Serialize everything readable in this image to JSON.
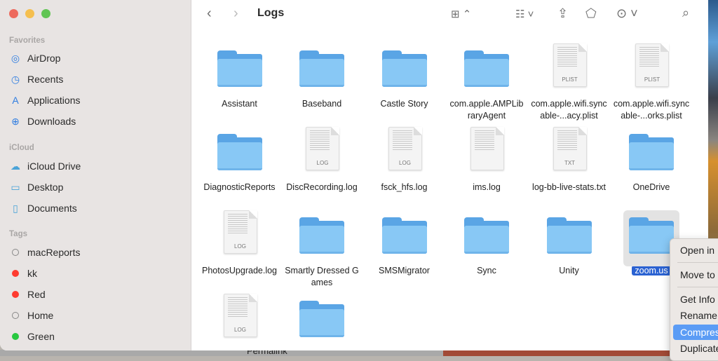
{
  "window": {
    "title": "Logs"
  },
  "sidebar": {
    "sections": [
      {
        "title": "Favorites",
        "items": [
          {
            "label": "AirDrop",
            "icon": "airdrop-icon"
          },
          {
            "label": "Recents",
            "icon": "clock-icon"
          },
          {
            "label": "Applications",
            "icon": "applications-icon"
          },
          {
            "label": "Downloads",
            "icon": "download-icon"
          }
        ]
      },
      {
        "title": "iCloud",
        "items": [
          {
            "label": "iCloud Drive",
            "icon": "cloud-icon"
          },
          {
            "label": "Desktop",
            "icon": "desktop-icon"
          },
          {
            "label": "Documents",
            "icon": "document-icon"
          }
        ]
      },
      {
        "title": "Tags",
        "items": [
          {
            "label": "macReports",
            "color": ""
          },
          {
            "label": "kk",
            "color": "#fe3b30"
          },
          {
            "label": "Red",
            "color": "#fe3b30"
          },
          {
            "label": "Home",
            "color": ""
          },
          {
            "label": "Green",
            "color": "#28c840"
          }
        ]
      }
    ]
  },
  "files": [
    {
      "name": "Assistant",
      "type": "folder"
    },
    {
      "name": "Baseband",
      "type": "folder"
    },
    {
      "name": "Castle Story",
      "type": "folder"
    },
    {
      "name": "com.apple.AMPLibraryAgent",
      "type": "folder"
    },
    {
      "name": "com.apple.wifi.syncable-...acy.plist",
      "type": "doc",
      "ext": "PLIST"
    },
    {
      "name": "com.apple.wifi.syncable-...orks.plist",
      "type": "doc",
      "ext": "PLIST"
    },
    {
      "name": "DiagnosticReports",
      "type": "folder"
    },
    {
      "name": "DiscRecording.log",
      "type": "doc",
      "ext": "LOG"
    },
    {
      "name": "fsck_hfs.log",
      "type": "doc",
      "ext": "LOG"
    },
    {
      "name": "ims.log",
      "type": "doc",
      "ext": ""
    },
    {
      "name": "log-bb-live-stats.txt",
      "type": "doc",
      "ext": "TXT"
    },
    {
      "name": "OneDrive",
      "type": "folder"
    },
    {
      "name": "PhotosUpgrade.log",
      "type": "doc",
      "ext": "LOG"
    },
    {
      "name": "Smartly Dressed Games",
      "type": "folder"
    },
    {
      "name": "SMSMigrator",
      "type": "folder"
    },
    {
      "name": "Sync",
      "type": "folder"
    },
    {
      "name": "Unity",
      "type": "folder"
    },
    {
      "name": "zoom.us",
      "type": "folder",
      "selected": true
    },
    {
      "name": "",
      "type": "doc",
      "ext": "LOG"
    },
    {
      "name": "",
      "type": "folder"
    }
  ],
  "context_menu": {
    "items": [
      "Open in",
      "Move to",
      "Get Info",
      "Rename",
      "Compress",
      "Duplicate"
    ],
    "highlighted": "Compress"
  },
  "background": {
    "text": "Permalink"
  }
}
